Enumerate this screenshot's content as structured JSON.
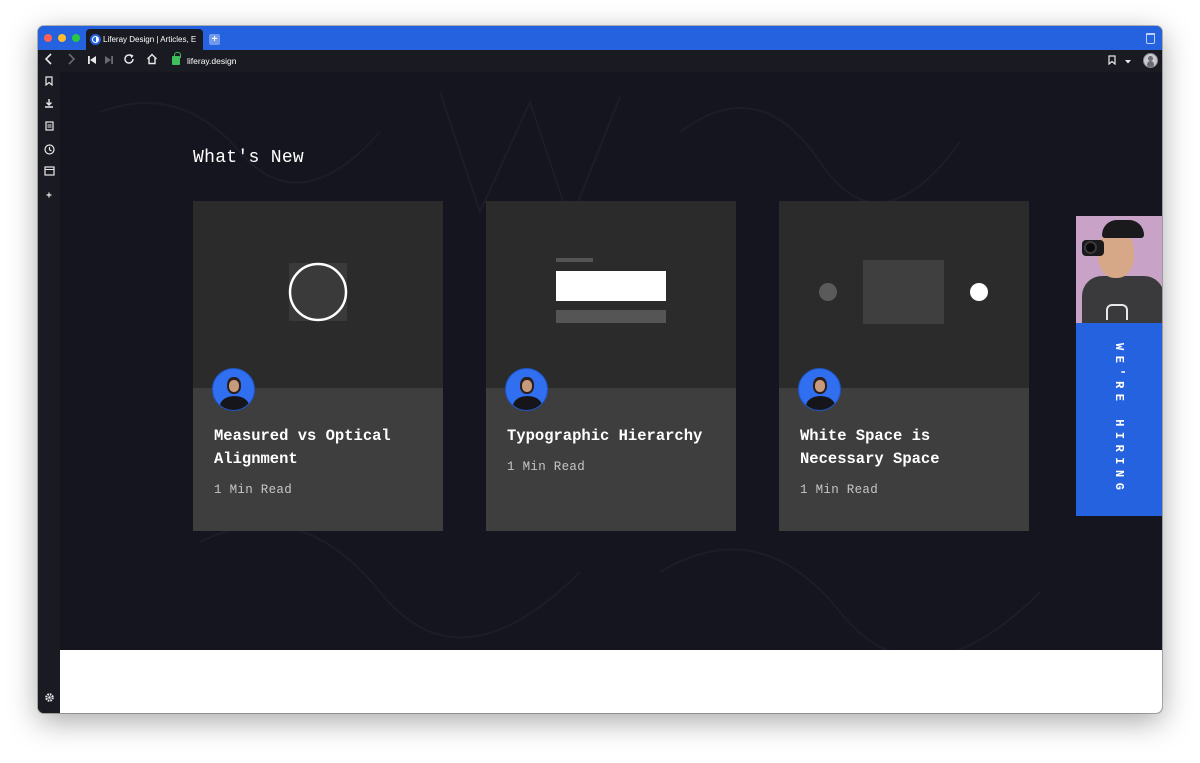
{
  "browser": {
    "tab_title": "Liferay Design | Articles, E",
    "url": "liferay.design",
    "icons": {
      "back": "back-arrow-icon",
      "forward": "forward-arrow-icon",
      "skip_back": "skip-back-icon",
      "skip_forward": "skip-forward-icon",
      "reload": "reload-icon",
      "home": "home-icon",
      "lock": "lock-icon",
      "bookmark": "bookmark-icon",
      "menu": "chevron-down-icon",
      "profile": "profile-avatar",
      "new_tab": "plus-icon",
      "trash": "trash-icon"
    }
  },
  "sidebar": {
    "items": [
      {
        "icon": "bookmark-icon"
      },
      {
        "icon": "download-icon"
      },
      {
        "icon": "notes-icon"
      },
      {
        "icon": "history-icon"
      },
      {
        "icon": "window-icon"
      },
      {
        "icon": "plus-icon"
      }
    ],
    "settings_icon": "gear-icon"
  },
  "main": {
    "section_title": "What's New",
    "cards": [
      {
        "title": "Measured vs Optical Alignment",
        "meta": "1 Min Read"
      },
      {
        "title": "Typographic Hierarchy",
        "meta": "1 Min Read"
      },
      {
        "title": "White Space is Necessary Space",
        "meta": "1 Min Read"
      }
    ],
    "hiring": {
      "label": "WE'RE HIRING"
    }
  },
  "colors": {
    "accent": "#2462e0",
    "page_bg": "#15151f",
    "card_top": "#2b2b2b",
    "card_bottom": "#3e3e3e"
  }
}
